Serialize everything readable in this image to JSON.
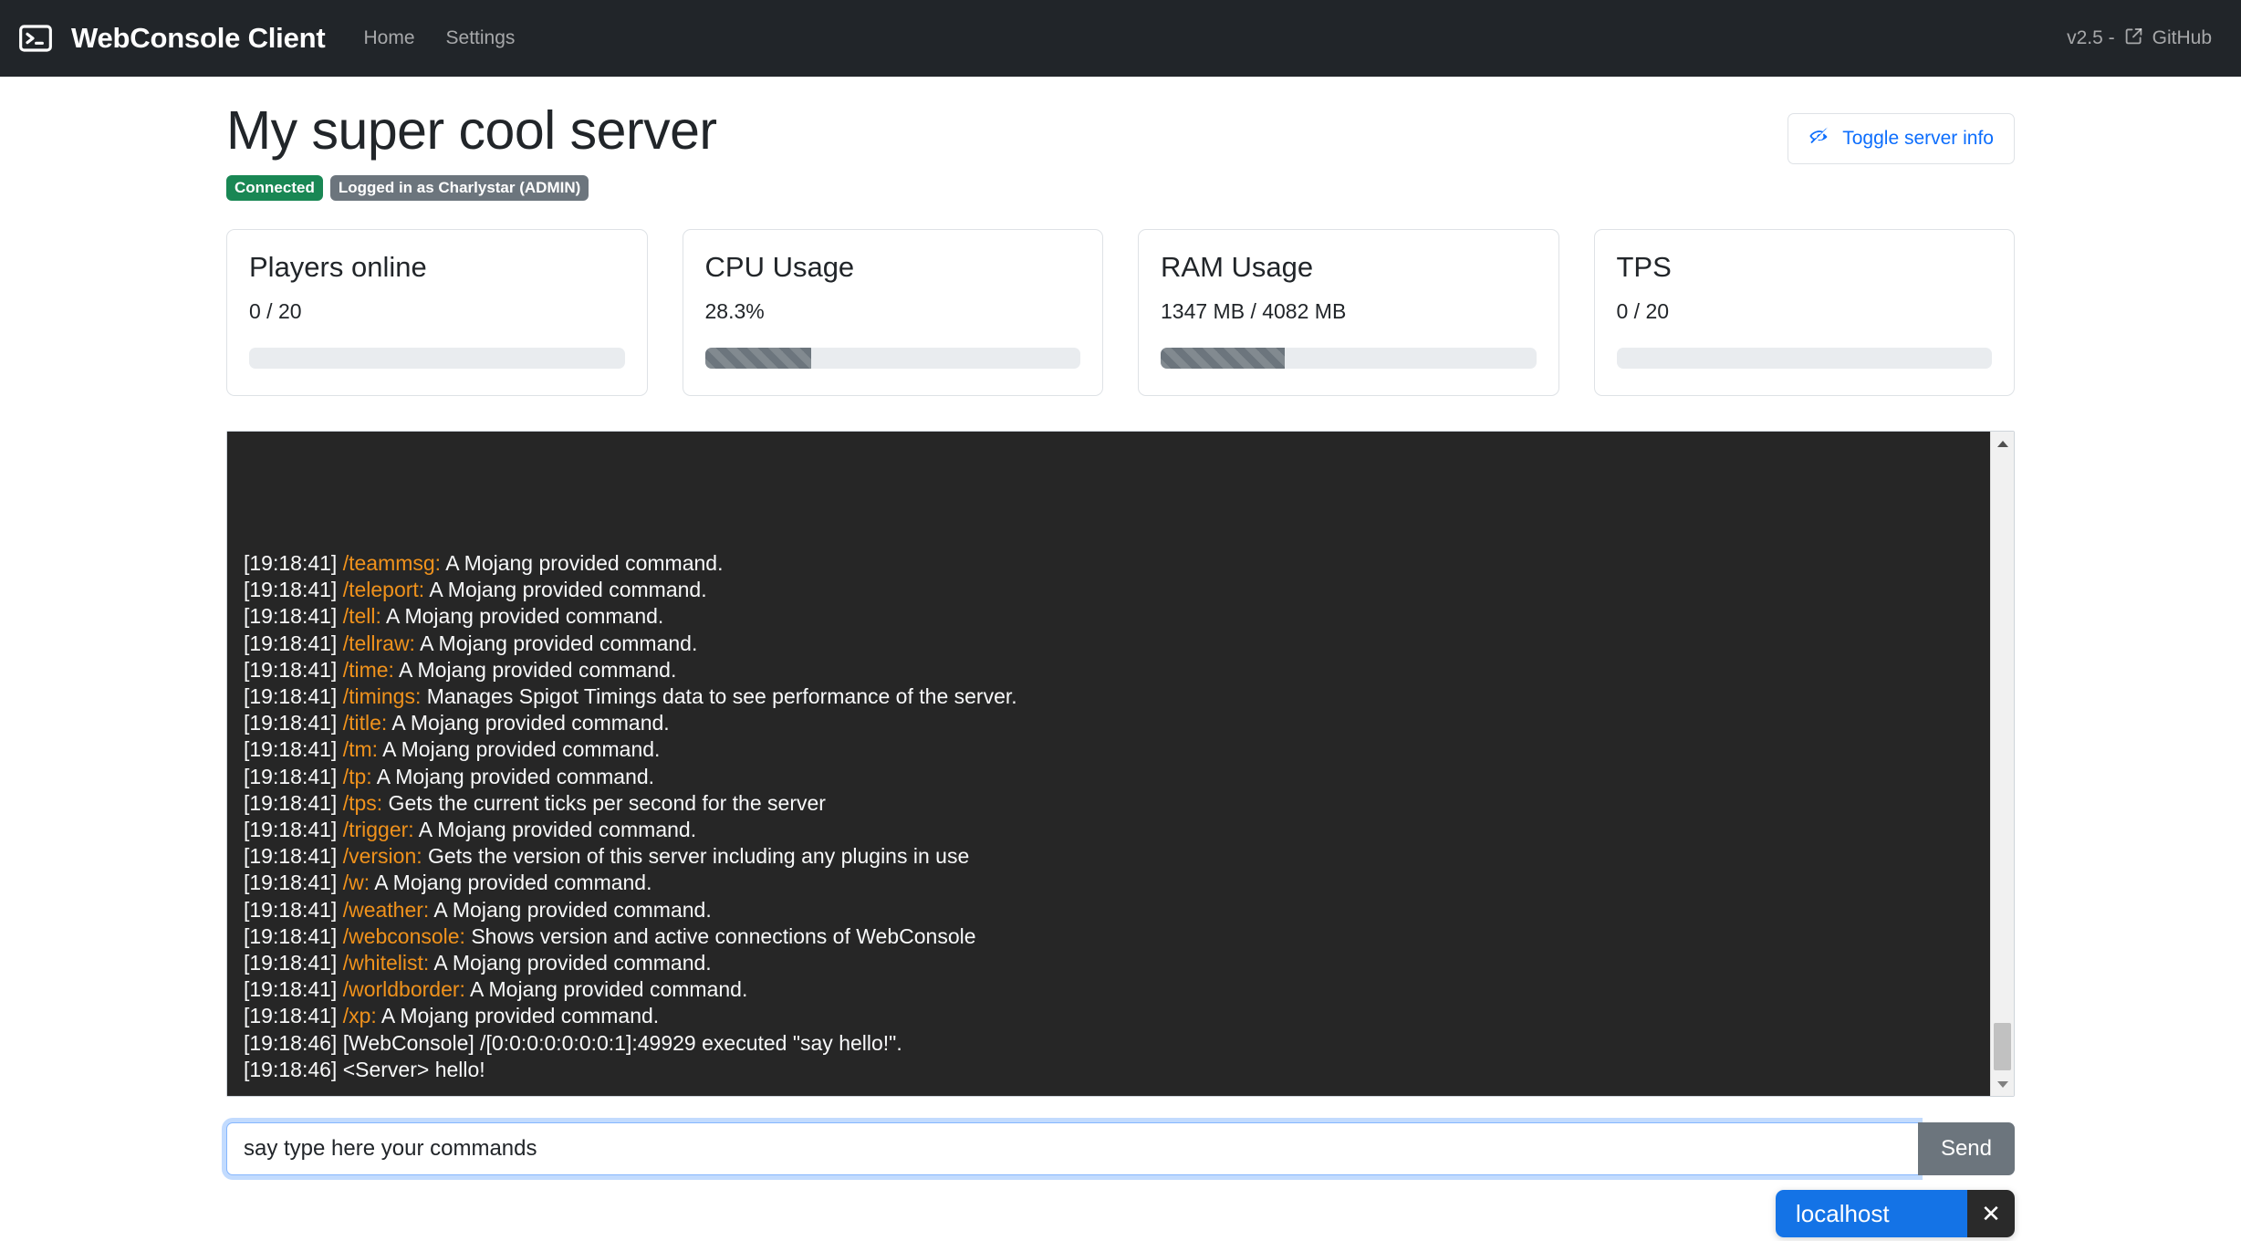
{
  "navbar": {
    "brand_icon": "terminal-icon",
    "brand": "WebConsole Client",
    "links": [
      {
        "label": "Home"
      },
      {
        "label": "Settings"
      }
    ],
    "version_text": "v2.5 -",
    "github_label": "GitHub",
    "github_icon": "external-link-icon",
    "background": "#212529"
  },
  "header": {
    "title": "My super cool server",
    "toggle_button": {
      "label": "Toggle server info",
      "icon": "eye-slash-icon",
      "color": "#0d6efd"
    },
    "badges": [
      {
        "label": "Connected",
        "variant": "success",
        "color": "#198754"
      },
      {
        "label": "Logged in as Charlystar (ADMIN)",
        "variant": "secondary",
        "color": "#6c757d"
      }
    ]
  },
  "stats": [
    {
      "title": "Players online",
      "value": "0 / 20",
      "percent": 0,
      "striped": false
    },
    {
      "title": "CPU Usage",
      "value": "28.3%",
      "percent": 28.3,
      "striped": true
    },
    {
      "title": "RAM Usage",
      "value": "1347 MB / 4082 MB",
      "percent": 33,
      "striped": true
    },
    {
      "title": "TPS",
      "value": "0 / 20",
      "percent": 0,
      "striped": false
    }
  ],
  "console": {
    "lines": [
      {
        "time": "[19:18:41]",
        "cmd": "/teammsg:",
        "text": " A Mojang provided command.",
        "clipped": true
      },
      {
        "time": "[19:18:41]",
        "cmd": "/teleport:",
        "text": " A Mojang provided command."
      },
      {
        "time": "[19:18:41]",
        "cmd": "/tell:",
        "text": " A Mojang provided command."
      },
      {
        "time": "[19:18:41]",
        "cmd": "/tellraw:",
        "text": " A Mojang provided command."
      },
      {
        "time": "[19:18:41]",
        "cmd": "/time:",
        "text": " A Mojang provided command."
      },
      {
        "time": "[19:18:41]",
        "cmd": "/timings:",
        "text": " Manages Spigot Timings data to see performance of the server."
      },
      {
        "time": "[19:18:41]",
        "cmd": "/title:",
        "text": " A Mojang provided command."
      },
      {
        "time": "[19:18:41]",
        "cmd": "/tm:",
        "text": " A Mojang provided command."
      },
      {
        "time": "[19:18:41]",
        "cmd": "/tp:",
        "text": " A Mojang provided command."
      },
      {
        "time": "[19:18:41]",
        "cmd": "/tps:",
        "text": " Gets the current ticks per second for the server"
      },
      {
        "time": "[19:18:41]",
        "cmd": "/trigger:",
        "text": " A Mojang provided command."
      },
      {
        "time": "[19:18:41]",
        "cmd": "/version:",
        "text": " Gets the version of this server including any plugins in use"
      },
      {
        "time": "[19:18:41]",
        "cmd": "/w:",
        "text": " A Mojang provided command."
      },
      {
        "time": "[19:18:41]",
        "cmd": "/weather:",
        "text": " A Mojang provided command."
      },
      {
        "time": "[19:18:41]",
        "cmd": "/webconsole:",
        "text": " Shows version and active connections of WebConsole"
      },
      {
        "time": "[19:18:41]",
        "cmd": "/whitelist:",
        "text": " A Mojang provided command."
      },
      {
        "time": "[19:18:41]",
        "cmd": "/worldborder:",
        "text": " A Mojang provided command."
      },
      {
        "time": "[19:18:41]",
        "cmd": "/xp:",
        "text": " A Mojang provided command."
      },
      {
        "time": "[19:18:46]",
        "cmd": "",
        "text": " [WebConsole] /[0:0:0:0:0:0:0:1]:49929 executed \"say hello!\"."
      },
      {
        "time": "[19:18:46]",
        "cmd": "",
        "text": " <Server> hello!"
      }
    ],
    "background": "#262626",
    "text_color": "#f8f9fa",
    "command_color": "#f0921c",
    "scrollbar": {
      "up_arrow_icon": "caret-up-icon",
      "down_arrow_icon": "caret-down-icon",
      "position": "bottom"
    }
  },
  "command_bar": {
    "input_value": "say type here your commands",
    "input_placeholder": "",
    "send_label": "Send"
  },
  "toast": {
    "message": "localhost",
    "close_icon": "close-icon",
    "background": "#1473e6"
  }
}
